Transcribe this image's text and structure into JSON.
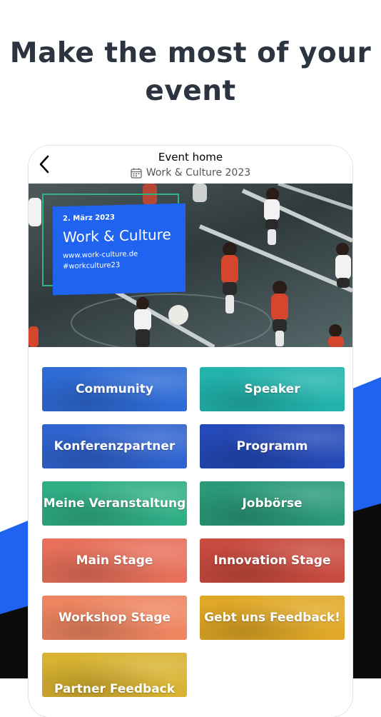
{
  "headline": {
    "line1": "Make the most of your",
    "line2": "event"
  },
  "topbar": {
    "title": "Event home",
    "subtitle": "Work & Culture 2023"
  },
  "hero": {
    "date": "2. März 2023",
    "name": "Work & Culture",
    "url": "www.work-culture.de",
    "hashtag": "#workculture23"
  },
  "tiles": [
    {
      "label": "Community",
      "color": "#2e6bd6"
    },
    {
      "label": "Speaker",
      "color": "#22b3ad"
    },
    {
      "label": "Konferenzpartner",
      "color": "#2f63cf"
    },
    {
      "label": "Programm",
      "color": "#2449b8"
    },
    {
      "label": "Meine Veranstaltung",
      "color": "#2fae86"
    },
    {
      "label": "Jobbörse",
      "color": "#2a9a78"
    },
    {
      "label": "Main Stage",
      "color": "#e8705a"
    },
    {
      "label": "Innovation Stage",
      "color": "#c94a3f"
    },
    {
      "label": "Workshop Stage",
      "color": "#ee8560"
    },
    {
      "label": "Gebt uns Feedback!",
      "color": "#e0a826"
    },
    {
      "label": "Partner Feedback",
      "color": "#d8b230"
    }
  ],
  "colors": {
    "brand_blue": "#1f63f0",
    "dark": "#0b0b0b",
    "text": "#2c3440"
  }
}
